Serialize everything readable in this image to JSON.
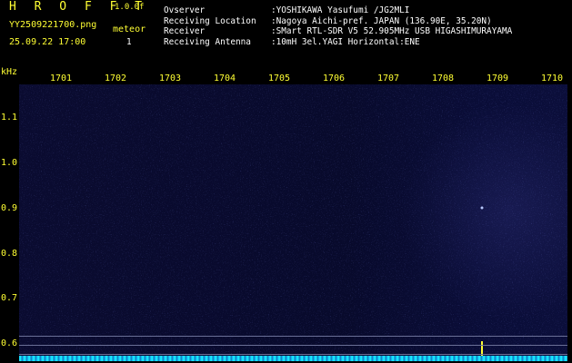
{
  "header": {
    "brand": "H R O F F T",
    "version": "1.0.0f",
    "filename": "YY2509221700.png",
    "datetime": "25.09.22 17:00",
    "meteor_label": "meteor",
    "meteor_count": "1",
    "info": [
      {
        "key": "Ovserver",
        "value": ":YOSHIKAWA Yasufumi /JG2MLI"
      },
      {
        "key": "Receiving Location",
        "value": ":Nagoya Aichi-pref. JAPAN (136.90E, 35.20N)"
      },
      {
        "key": "Receiver",
        "value": ":SMart RTL-SDR V5 52.905MHz USB HIGASHIMURAYAMA"
      },
      {
        "key": "Receiving Antenna",
        "value": ":10mH 3el.YAGI Horizontal:ENE"
      }
    ]
  },
  "yaxis": {
    "unit": "kHz",
    "ticks": [
      "1.1",
      "1.0",
      "0.9",
      "0.8",
      "0.7",
      "0.6"
    ]
  },
  "xaxis": {
    "ticks": [
      "1701",
      "1702",
      "1703",
      "1704",
      "1705",
      "1706",
      "1707",
      "1708",
      "1709",
      "1710"
    ]
  },
  "colors": {
    "label": "#ffff33",
    "background": "#000000",
    "spectrogram": "#0a0c34",
    "fringe": "#19e8ff"
  }
}
